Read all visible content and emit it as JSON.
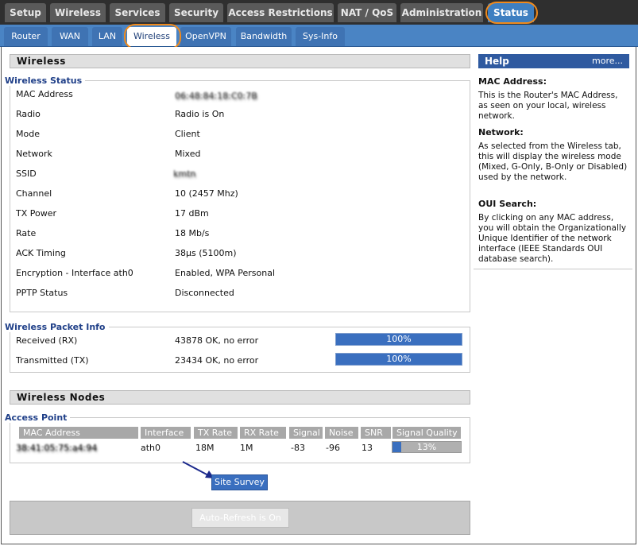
{
  "nav": {
    "top_tabs": [
      "Setup",
      "Wireless",
      "Services",
      "Security",
      "Access Restrictions",
      "NAT / QoS",
      "Administration",
      "Status"
    ],
    "sub_tabs": [
      "Router",
      "WAN",
      "LAN",
      "Wireless",
      "OpenVPN",
      "Bandwidth",
      "Sys-Info"
    ]
  },
  "wireless_section": {
    "title": "Wireless"
  },
  "wireless_status": {
    "legend": "Wireless Status",
    "rows": [
      {
        "label": "MAC Address",
        "value": "06:48:84:18:C0:7B"
      },
      {
        "label": "Radio",
        "value": "Radio is On"
      },
      {
        "label": "Mode",
        "value": "Client"
      },
      {
        "label": "Network",
        "value": "Mixed"
      },
      {
        "label": "SSID",
        "value": "kmtn"
      },
      {
        "label": "Channel",
        "value": "10 (2457 Mhz)"
      },
      {
        "label": "TX Power",
        "value": "17 dBm"
      },
      {
        "label": "Rate",
        "value": "18 Mb/s"
      },
      {
        "label": "ACK Timing",
        "value": "38µs (5100m)"
      },
      {
        "label": "Encryption - Interface ath0",
        "value": "Enabled, WPA Personal"
      },
      {
        "label": "PPTP Status",
        "value": "Disconnected"
      }
    ]
  },
  "packet_info": {
    "legend": "Wireless Packet Info",
    "rows": [
      {
        "label": "Received (RX)",
        "value": "43878 OK, no error",
        "bar": "100%",
        "percent": 100
      },
      {
        "label": "Transmitted (TX)",
        "value": "23434 OK, no error",
        "bar": "100%",
        "percent": 100
      }
    ]
  },
  "wireless_nodes": {
    "title": "Wireless Nodes"
  },
  "access_point": {
    "legend": "Access Point",
    "headers": [
      "MAC Address",
      "Interface",
      "TX Rate",
      "RX Rate",
      "Signal",
      "Noise",
      "SNR",
      "Signal Quality"
    ],
    "row": {
      "mac": "38:41:05:75:a4:94",
      "interface": "ath0",
      "tx_rate": "18M",
      "rx_rate": "1M",
      "signal": "-83",
      "noise": "-96",
      "snr": "13",
      "quality": "13%",
      "quality_percent": 13
    }
  },
  "buttons": {
    "site_survey": "Site Survey",
    "auto_refresh": "Auto-Refresh is On"
  },
  "help": {
    "title": "Help",
    "more": "more...",
    "sections": [
      {
        "title": "MAC Address:",
        "text": "This is the Router's MAC Address, as seen on your local, wireless network."
      },
      {
        "title": "Network:",
        "text": "As selected from the Wireless tab, this will display the wireless mode (Mixed, G-Only, B-Only or Disabled) used by the network."
      },
      {
        "title": "OUI Search:",
        "text": "By clicking on any MAC address, you will obtain the Organizationally Unique Identifier of the network interface (IEEE Standards OUI database search)."
      }
    ]
  },
  "colors": {
    "accent": "#3a6fbf",
    "highlight_ring": "#f08a1c",
    "legend_text": "#1f3f88"
  }
}
